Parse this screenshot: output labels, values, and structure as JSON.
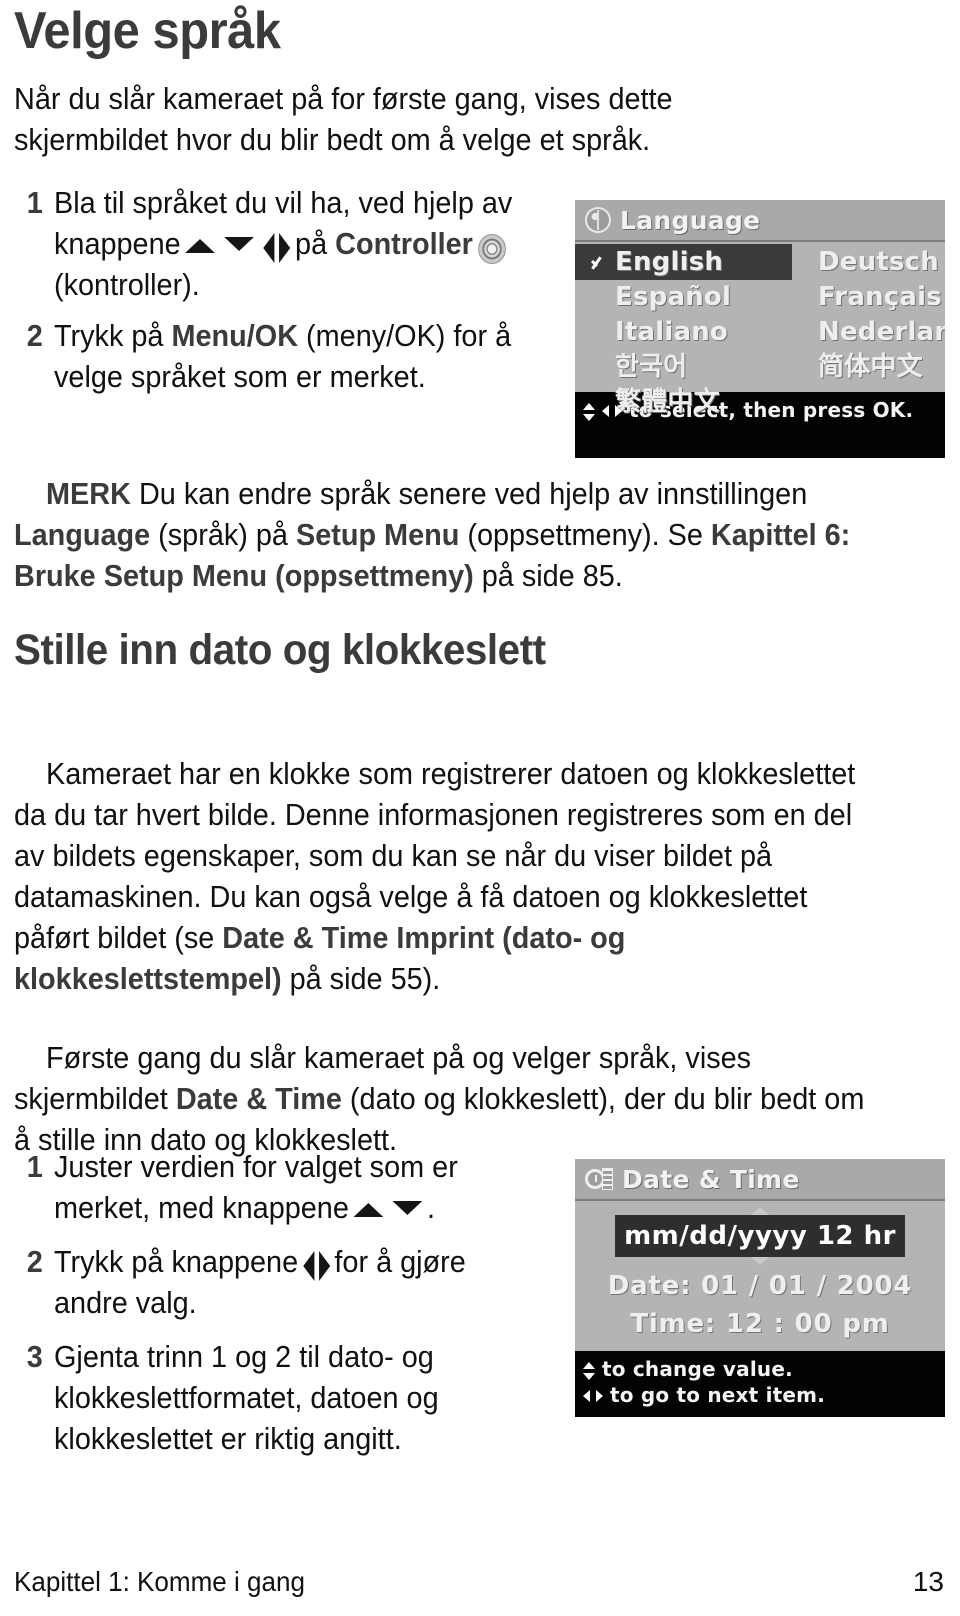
{
  "document": {
    "title": "Velge språk",
    "intro": "Når du slår kameraet på for første gang, vises dette skjermbildet hvor du blir bedt om å velge et språk."
  },
  "language_steps": [
    {
      "number": "1",
      "text_before": "Bla til språket du vil ha, ved hjelp av knappene",
      "icons": [
        "up-arrow-icon",
        "down-arrow-icon",
        "left-arrow-icon",
        "right-arrow-icon"
      ],
      "text_mid": "på",
      "bold_label": "Controller",
      "controller_icon": "controller-dial-icon",
      "text_after": "(kontroller)."
    },
    {
      "number": "2",
      "text_before": "Trykk på",
      "bold_label": "Menu/OK",
      "text_after": "(meny/OK) for å velge språket som er merket."
    }
  ],
  "note": {
    "label": "MERK",
    "line1_a": "Du kan endre språk senere ved hjelp av innstillingen ",
    "line1_bold": "Language",
    "line1_b": " (språk) på ",
    "line2_bold_a": "Setup Menu",
    "line2_a": " (oppsettmeny). Se ",
    "line2_bold_b": "Kapittel 6: Bruke Setup Menu (oppsettmeny)",
    "line2_b": " på side 85."
  },
  "language_screen": {
    "title": "Language",
    "title_icon": "globe-icon",
    "selected_icon": "checkmark-icon",
    "left_column": [
      "English",
      "Español",
      "Italiano",
      "한국어",
      "繁體中文"
    ],
    "right_column": [
      "Deutsch",
      "Français",
      "Nederlands",
      "简体中文"
    ],
    "selected": "English",
    "footer_hint": "to select, then press OK.",
    "footer_icons": [
      "updown-arrow-icon",
      "leftright-arrow-icon"
    ]
  },
  "datetime_section": {
    "heading": "Stille inn dato og klokkeslett",
    "para1_a": "Kameraet har en klokke som registrerer datoen og klokkeslettet da du tar hvert bilde. Denne informasjonen registreres som en del av bildets egenskaper, som du kan se når du viser bildet på datamaskinen. Du kan også velge å få datoen og klokkeslettet påført bildet (se ",
    "para1_bold": "Date & Time Imprint (dato- og klokkeslettstempel)",
    "para1_b": " på side 55).",
    "para2_a": "Første gang du slår kameraet på og velger språk, vises skjermbildet ",
    "para2_bold": "Date & Time",
    "para2_b": " (dato og klokkeslett), der du blir bedt om å stille inn dato og klokkeslett."
  },
  "datetime_steps": [
    {
      "number": "1",
      "text_before": "Juster verdien for valget som er merket, med knappene",
      "icons": [
        "up-arrow-icon",
        "down-arrow-icon"
      ],
      "text_after": "."
    },
    {
      "number": "2",
      "text_before": "Trykk på knappene",
      "icons": [
        "left-arrow-icon",
        "right-arrow-icon"
      ],
      "text_after": "for å gjøre andre valg."
    },
    {
      "number": "3",
      "text_before": "Gjenta trinn 1 og 2 til dato- og klokkeslettformatet, datoen og klokkeslettet er riktig angitt.",
      "icons": [],
      "text_after": ""
    }
  ],
  "datetime_screen": {
    "title": "Date & Time",
    "title_icon": "clock-page-icon",
    "format_value": "mm/dd/yyyy  12 hr",
    "date_label": "Date:",
    "date_value": "01 / 01 / 2004",
    "time_label": "Time:",
    "time_value": "12 : 00 pm",
    "footer_hint_1": "to change value.",
    "footer_hint_2": "to go to next item.",
    "footer_icon_1": "updown-arrow-icon",
    "footer_icon_2": "leftright-arrow-icon"
  },
  "footer": {
    "chapter": "Kapittel 1: Komme i gang",
    "page_number": "13"
  },
  "colors": {
    "heading": "#3b3b3b",
    "body": "#111111",
    "lcd_background": "#b4b4b4",
    "lcd_title_bar": "#a9a9a9",
    "lcd_footer": "#030303",
    "lcd_selected": "#3a3a3a"
  }
}
